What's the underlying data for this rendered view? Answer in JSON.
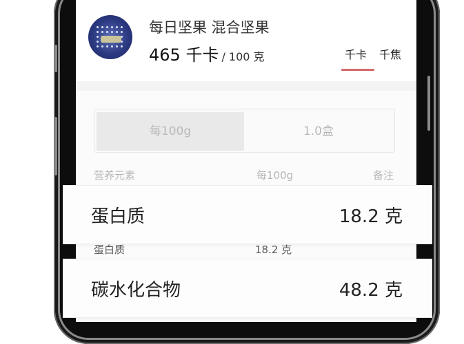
{
  "header": {
    "title": "每日坚果 混合坚果",
    "energy_value": "465 千卡",
    "energy_per": "/ 100 克",
    "unit_tabs": [
      {
        "label": "千卡",
        "active": true
      },
      {
        "label": "千焦",
        "active": false
      }
    ],
    "accent_color": "#d46a6a"
  },
  "segment": {
    "options": [
      {
        "label": "每100g",
        "active": true
      },
      {
        "label": "1.0盒",
        "active": false
      }
    ]
  },
  "table": {
    "headers": [
      "营养元素",
      "每100g",
      "备注"
    ],
    "rows": [
      {
        "name": "蛋白质",
        "value": "18.2 克"
      }
    ]
  },
  "highlight_cards": [
    {
      "name": "蛋白质",
      "value": "18.2 克"
    },
    {
      "name": "碳水化合物",
      "value": "48.2 克"
    }
  ]
}
